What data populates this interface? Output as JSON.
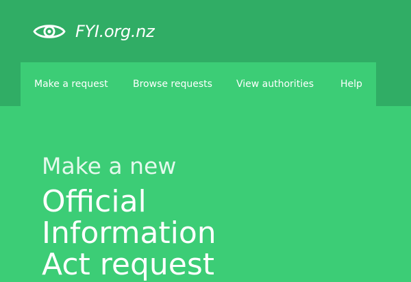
{
  "site": {
    "name": "FYI.org.nz",
    "logo_icon": "eye-icon"
  },
  "nav": {
    "items": [
      {
        "label": "Make a request"
      },
      {
        "label": "Browse requests"
      },
      {
        "label": "View authorities"
      },
      {
        "label": "Help"
      }
    ]
  },
  "hero": {
    "intro": "Make a new",
    "title_lines": [
      "Official",
      "Information",
      "Act request"
    ]
  },
  "colors": {
    "header_background": "#30ad65",
    "page_background": "#3ccd76",
    "text": "#ffffff"
  }
}
